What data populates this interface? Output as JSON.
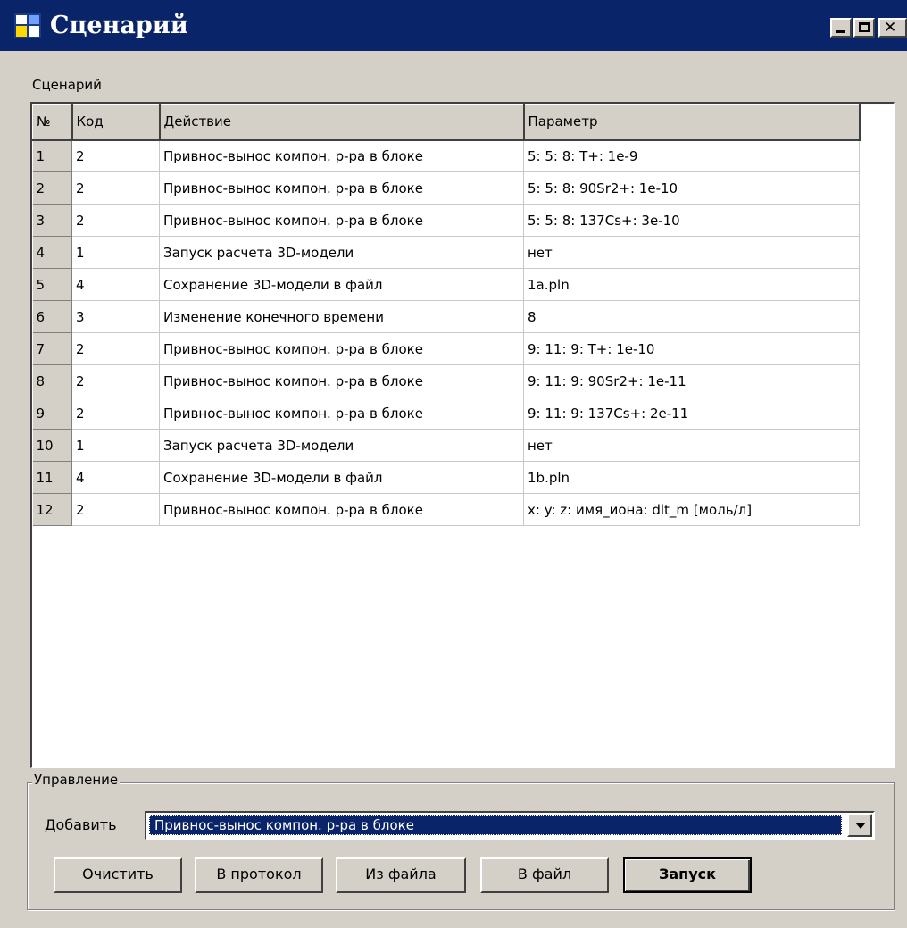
{
  "window": {
    "title": "Сценарий",
    "title_bar_color": "#0a246a",
    "controls": {
      "minimize": "minimize-icon",
      "maximize": "maximize-icon",
      "close": "✕"
    }
  },
  "scenario": {
    "group_label": "Сценарий",
    "columns": [
      "№",
      "Код",
      "Действие",
      "Параметр"
    ],
    "rows": [
      [
        "1",
        "2",
        "Привнос-вынос компон. р-ра в блоке",
        "5: 5: 8: T+: 1e-9"
      ],
      [
        "2",
        "2",
        "Привнос-вынос компон. р-ра в блоке",
        "5: 5: 8: 90Sr2+: 1e-10"
      ],
      [
        "3",
        "2",
        "Привнос-вынос компон. р-ра в блоке",
        "5: 5: 8: 137Cs+: 3e-10"
      ],
      [
        "4",
        "1",
        "Запуск расчета 3D-модели",
        "нет"
      ],
      [
        "5",
        "4",
        "Сохранение 3D-модели в файл",
        "1a.pln"
      ],
      [
        "6",
        "3",
        "Изменение конечного времени",
        "8"
      ],
      [
        "7",
        "2",
        "Привнос-вынос компон. р-ра в блоке",
        "9: 11: 9: T+: 1e-10"
      ],
      [
        "8",
        "2",
        "Привнос-вынос компон. р-ра в блоке",
        "9: 11: 9: 90Sr2+: 1e-11"
      ],
      [
        "9",
        "2",
        "Привнос-вынос компон. р-ра в блоке",
        "9: 11: 9: 137Cs+: 2e-11"
      ],
      [
        "10",
        "1",
        "Запуск расчета 3D-модели",
        "нет"
      ],
      [
        "11",
        "4",
        "Сохранение 3D-модели в файл",
        "1b.pln"
      ],
      [
        "12",
        "2",
        "Привнос-вынос компон. р-ра в блоке",
        "x: y: z: имя_иона: dlt_m [моль/л]"
      ]
    ]
  },
  "control": {
    "group_label": "Управление",
    "add_label": "Добавить",
    "add_selected": "Привнос-вынос компон. р-ра в блоке",
    "buttons": {
      "clear": "Очистить",
      "to_log": "В протокол",
      "from_file": "Из файла",
      "to_file": "В файл",
      "run": "Запуск"
    }
  }
}
